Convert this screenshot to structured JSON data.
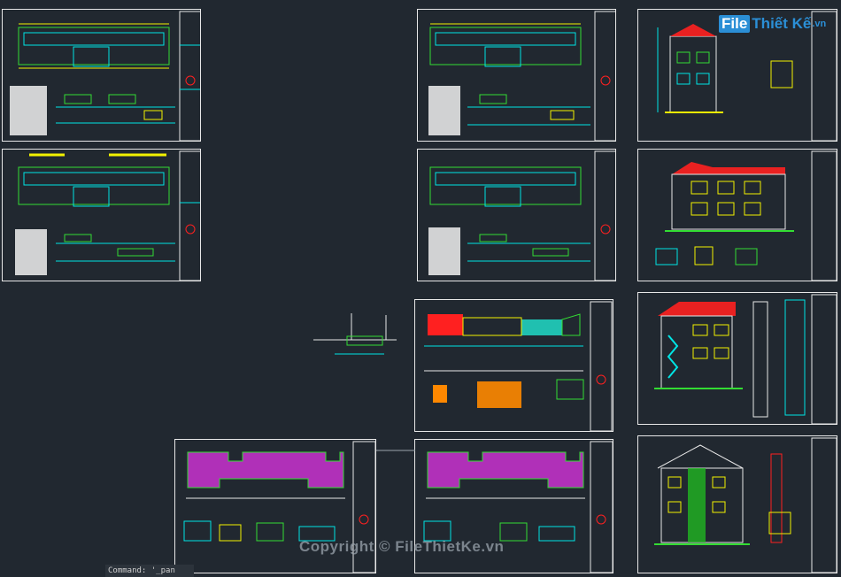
{
  "command_line": {
    "text": "Command: '_pan"
  },
  "watermark": {
    "text": "Copyright © FileThietKe.vn"
  },
  "logo": {
    "part1": "File",
    "part2": "Thiết Kế",
    "suffix": ".vn",
    "colors": {
      "brand": "#2b8fd6"
    }
  },
  "sheets": [
    {
      "id": "plan-1",
      "kind": "plan"
    },
    {
      "id": "plan-2",
      "kind": "plan"
    },
    {
      "id": "plan-3",
      "kind": "plan"
    },
    {
      "id": "plan-4",
      "kind": "plan"
    },
    {
      "id": "colored-plan",
      "kind": "colored-plan"
    },
    {
      "id": "roof-plan-1",
      "kind": "roof"
    },
    {
      "id": "roof-plan-2",
      "kind": "roof"
    },
    {
      "id": "elevation-1",
      "kind": "elevation"
    },
    {
      "id": "elevation-2",
      "kind": "elevation"
    },
    {
      "id": "section-1",
      "kind": "section"
    },
    {
      "id": "section-2",
      "kind": "section"
    }
  ],
  "colors": {
    "background": "#212830",
    "frame": "#e8e8e8",
    "cyan": "#00e5e5",
    "green": "#33dd33",
    "yellow": "#f2f200",
    "red": "#ff2020",
    "magenta": "#cc33cc",
    "white": "#f0f0f0"
  }
}
